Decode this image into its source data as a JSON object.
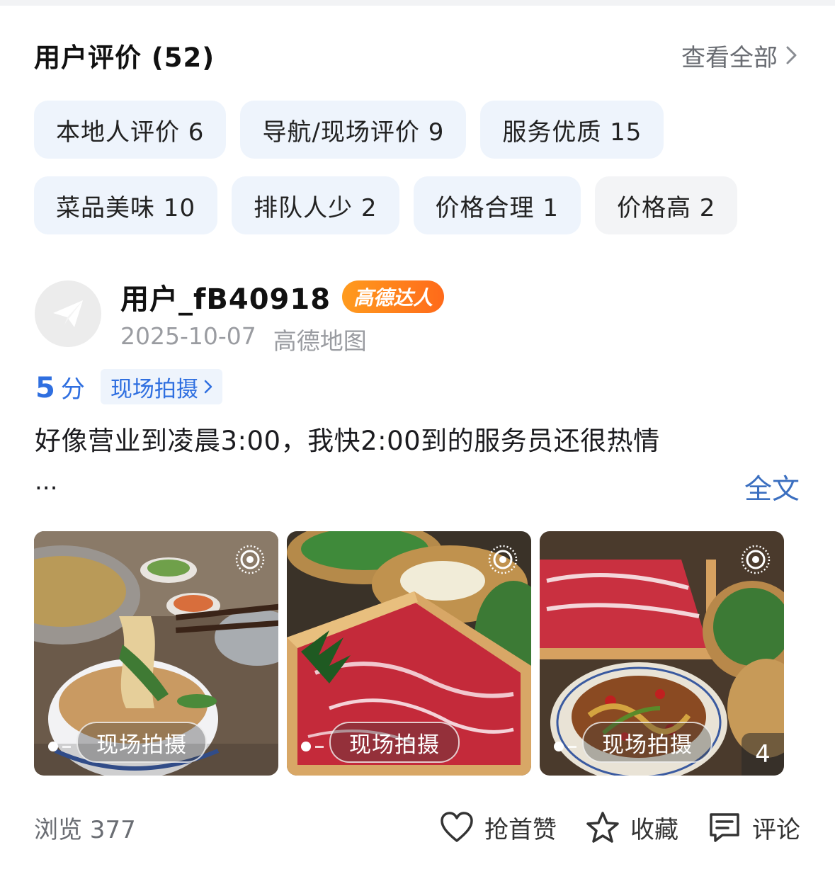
{
  "header": {
    "title": "用户评价 (52)",
    "view_all": "查看全部"
  },
  "tags": {
    "row1": [
      {
        "label": "本地人评价 6"
      },
      {
        "label": "导航/现场评价 9"
      },
      {
        "label": "服务优质 15"
      }
    ],
    "row2": [
      {
        "label": "菜品美味 10"
      },
      {
        "label": "排队人少 2"
      },
      {
        "label": "价格合理 1"
      },
      {
        "label": "价格高 2"
      }
    ]
  },
  "review": {
    "username": "用户_fB40918",
    "badge": "高德达人",
    "date": "2025-10-07",
    "source": "高德地图",
    "score_value": "5",
    "score_unit": "分",
    "onsite_link": "现场拍摄",
    "text": "好像营业到凌晨3:00，我快2:00到的服务员还很热情",
    "ellipsis": "...",
    "full_text": "全文",
    "photos": [
      {
        "label": "现场拍摄"
      },
      {
        "label": "现场拍摄"
      },
      {
        "label": "现场拍摄",
        "count": "4"
      }
    ]
  },
  "footer": {
    "views": "浏览 377",
    "like": "抢首赞",
    "favorite": "收藏",
    "comment": "评论"
  },
  "colors": {
    "accent_blue": "#2f6fe0",
    "tag_bg": "#eef4fc",
    "badge_orange": "#ff7d1d"
  },
  "icons": [
    "chevron-right-icon",
    "paper-plane-icon",
    "live-photo-icon",
    "heart-icon",
    "star-icon",
    "comment-icon"
  ]
}
